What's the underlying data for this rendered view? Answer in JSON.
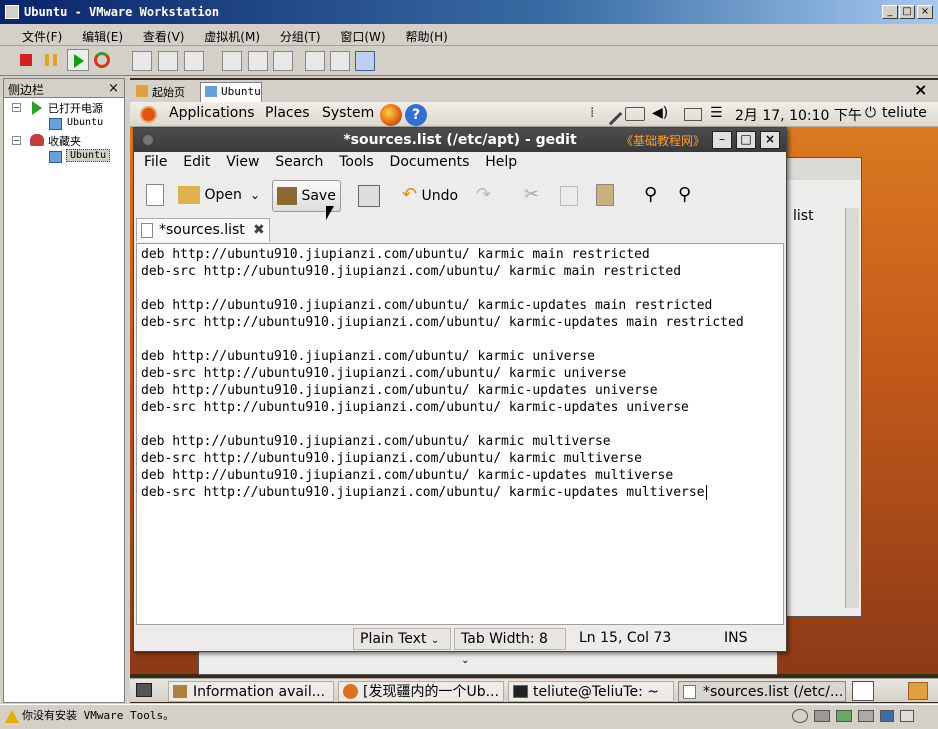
{
  "window": {
    "title": "Ubuntu - VMware Workstation",
    "min": "_",
    "max": "□",
    "close": "×"
  },
  "menubar": [
    {
      "label": "文件(F)"
    },
    {
      "label": "编辑(E)"
    },
    {
      "label": "查看(V)"
    },
    {
      "label": "虚拟机(M)"
    },
    {
      "label": "分组(T)"
    },
    {
      "label": "窗口(W)"
    },
    {
      "label": "帮助(H)"
    }
  ],
  "sidebar": {
    "title": "侧边栏",
    "close": "×",
    "groups": [
      {
        "label": "已打开电源",
        "child": "Ubuntu"
      },
      {
        "label": "收藏夹",
        "child": "Ubuntu"
      }
    ]
  },
  "vmtabs": {
    "tabs": [
      {
        "label": "起始页"
      },
      {
        "label": "Ubuntu"
      }
    ],
    "close": "×"
  },
  "gnome_panel": {
    "applications": "Applications",
    "places": "Places",
    "system": "System",
    "clock": "2月 17, 10:10 下午",
    "user": "teliute"
  },
  "gedit": {
    "title": "*sources.list (/etc/apt) - gedit",
    "watermark": "《基础教程网》",
    "menu": [
      {
        "label": "File"
      },
      {
        "label": "Edit"
      },
      {
        "label": "View"
      },
      {
        "label": "Search"
      },
      {
        "label": "Tools"
      },
      {
        "label": "Documents"
      },
      {
        "label": "Help"
      }
    ],
    "toolbar": {
      "open": "Open",
      "save": "Save",
      "undo": "Undo"
    },
    "tab_label": "*sources.list",
    "lines": [
      "deb http://ubuntu910.jiupianzi.com/ubuntu/ karmic main restricted",
      "deb-src http://ubuntu910.jiupianzi.com/ubuntu/ karmic main restricted",
      "",
      "deb http://ubuntu910.jiupianzi.com/ubuntu/ karmic-updates main restricted",
      "deb-src http://ubuntu910.jiupianzi.com/ubuntu/ karmic-updates main restricted",
      "",
      "deb http://ubuntu910.jiupianzi.com/ubuntu/ karmic universe",
      "deb-src http://ubuntu910.jiupianzi.com/ubuntu/ karmic universe",
      "deb http://ubuntu910.jiupianzi.com/ubuntu/ karmic-updates universe",
      "deb-src http://ubuntu910.jiupianzi.com/ubuntu/ karmic-updates universe",
      "",
      "deb http://ubuntu910.jiupianzi.com/ubuntu/ karmic multiverse",
      "deb-src http://ubuntu910.jiupianzi.com/ubuntu/ karmic multiverse",
      "deb http://ubuntu910.jiupianzi.com/ubuntu/ karmic-updates multiverse",
      "deb-src http://ubuntu910.jiupianzi.com/ubuntu/ karmic-updates multiverse"
    ],
    "status": {
      "lang": "Plain Text",
      "tabwidth": "Tab Width:  8",
      "pos": "Ln 15, Col 73",
      "mode": "INS"
    }
  },
  "bgwin": {
    "text": "list"
  },
  "taskbar": [
    {
      "label": "Information avail..."
    },
    {
      "label": "[发现疆内的一个Ub..."
    },
    {
      "label": "teliute@TeliuTe: ~"
    },
    {
      "label": "*sources.list (/etc/..."
    }
  ],
  "statusline": "你没有安装 VMware Tools。"
}
